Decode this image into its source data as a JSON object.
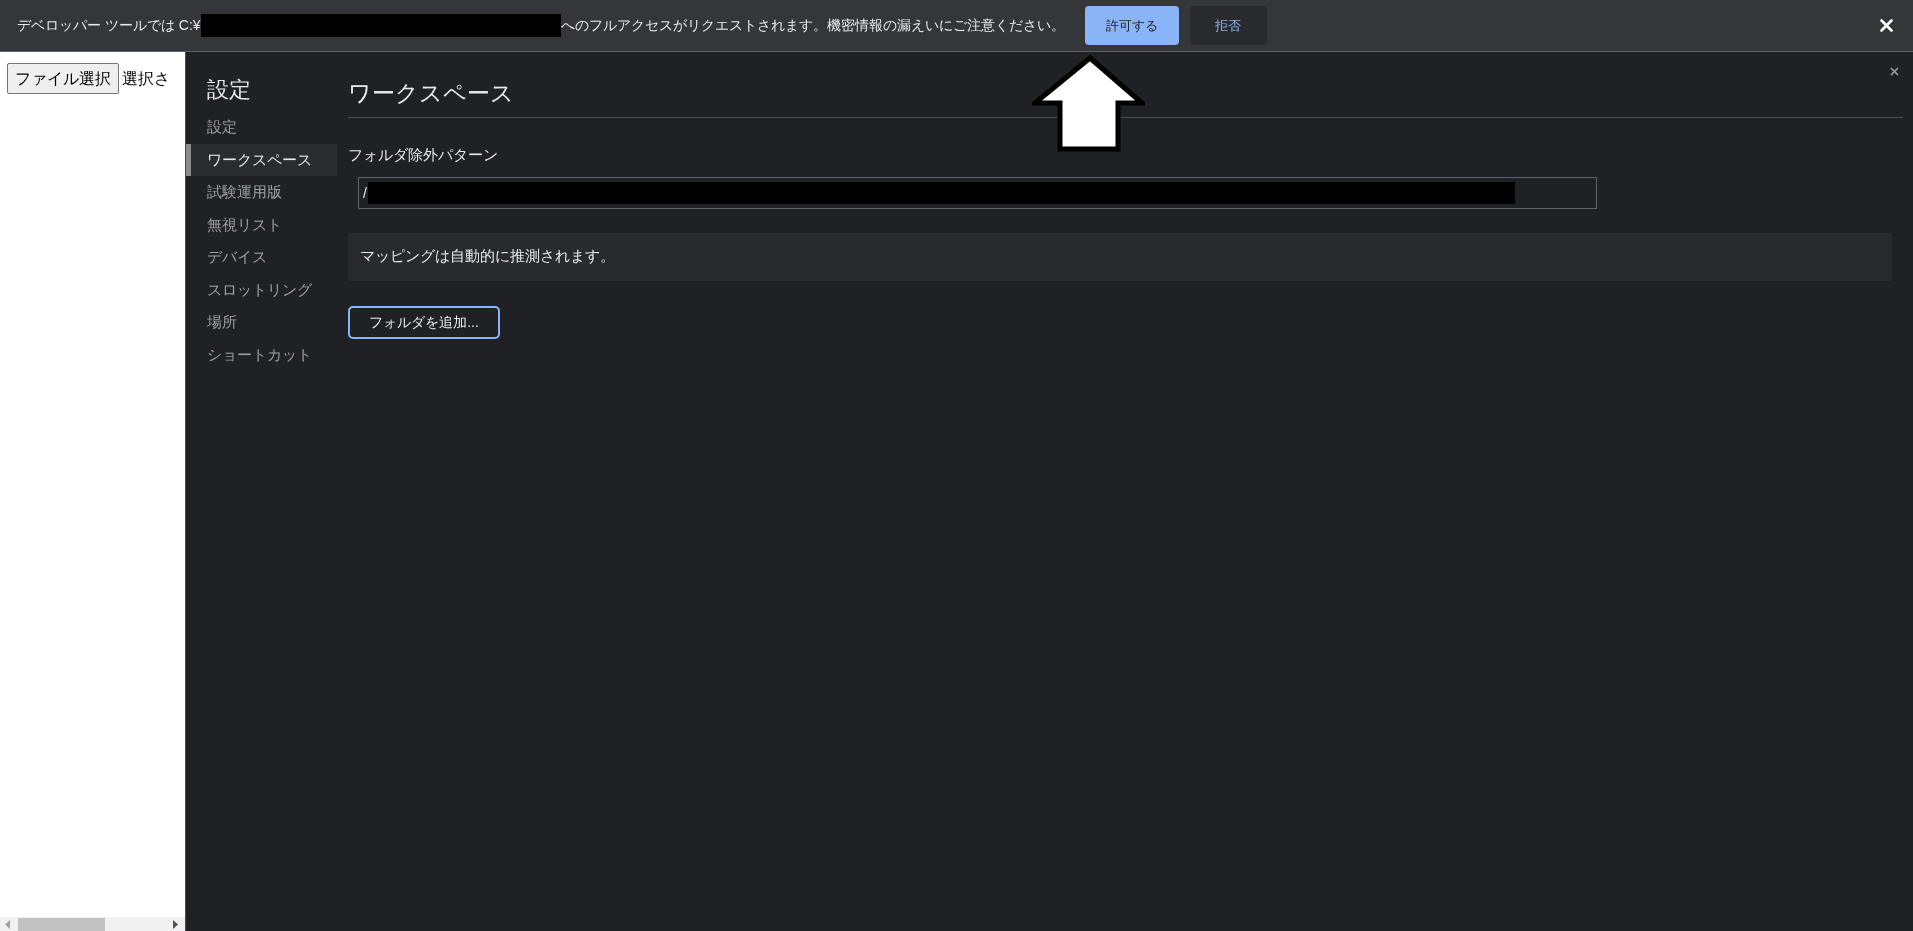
{
  "permission_bar": {
    "message_start": "デベロッパー ツールでは C:¥",
    "message_end": "へのフルアクセスがリクエストされます。機密情報の漏えいにご注意ください。",
    "buttons": [
      {
        "label": "許可する",
        "kind": "primary"
      },
      {
        "label": "拒否",
        "kind": "secondary"
      }
    ]
  },
  "page": {
    "file_button": "ファイル選択",
    "file_status": "選択さ"
  },
  "settings": {
    "title": "設定",
    "sidebar_items": [
      {
        "label": "設定",
        "selected": false
      },
      {
        "label": "ワークスペース",
        "selected": true
      },
      {
        "label": "試験運用版",
        "selected": false
      },
      {
        "label": "無視リスト",
        "selected": false
      },
      {
        "label": "デバイス",
        "selected": false
      },
      {
        "label": "スロットリング",
        "selected": false
      },
      {
        "label": "場所",
        "selected": false
      },
      {
        "label": "ショートカット",
        "selected": false
      }
    ],
    "panel_title": "ワークスペース",
    "exclude_label": "フォルダ除外パターン",
    "exclude_value": "/",
    "mapping_note": "マッピングは自動的に推測されます。",
    "add_button": "フォルダを追加..."
  }
}
